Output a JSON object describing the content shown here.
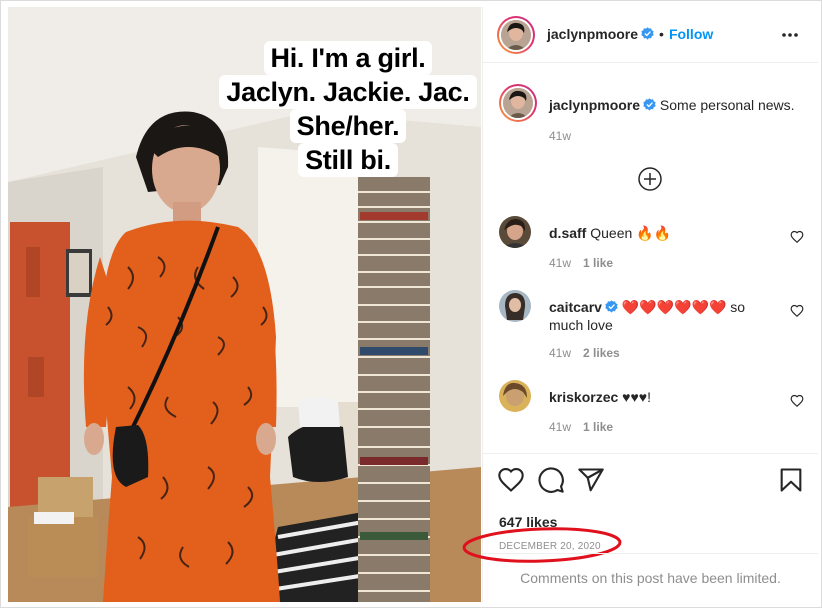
{
  "post": {
    "overlay_lines": [
      "Hi. I'm a girl.",
      "Jaclyn. Jackie. Jac.",
      "She/her.",
      "Still bi."
    ]
  },
  "header": {
    "username": "jaclynpmoore",
    "separator": "•",
    "follow_label": "Follow"
  },
  "caption": {
    "username": "jaclynpmoore",
    "text": "Some personal news.",
    "age": "41w"
  },
  "comments": [
    {
      "username": "d.saff",
      "text": "Queen 🔥🔥",
      "age": "41w",
      "likes": "1 like"
    },
    {
      "username": "caitcarv",
      "text": "❤️❤️❤️❤️❤️❤️ so much love",
      "age": "41w",
      "likes": "2 likes"
    },
    {
      "username": "kriskorzec",
      "text": "♥♥♥!",
      "age": "41w",
      "likes": "1 like"
    }
  ],
  "footer": {
    "likes_count": "647 likes",
    "date": "DECEMBER 20, 2020",
    "limited_notice": "Comments on this post have been limited."
  },
  "colors": {
    "accent": "#0095f6",
    "annotation_circle": "#e0101c",
    "dress": "#e35f1c"
  },
  "icons": [
    "verified-badge-icon",
    "more-options-icon",
    "load-more-plus-icon",
    "heart-icon",
    "comment-icon",
    "share-icon",
    "bookmark-icon"
  ]
}
